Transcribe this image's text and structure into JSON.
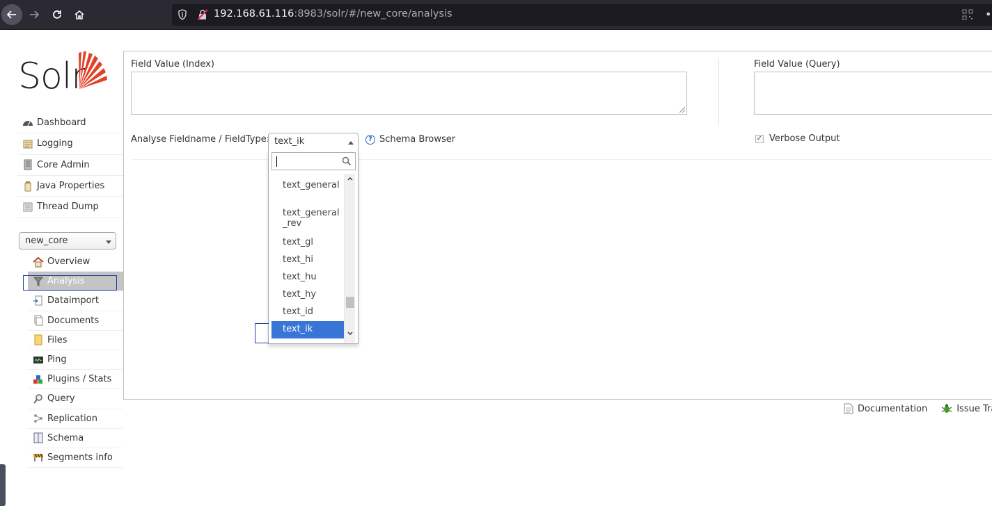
{
  "browser": {
    "url_host": "192.168.61.116",
    "url_rest": ":8983/solr/#/new_core/analysis"
  },
  "logo": {
    "text": "Solr"
  },
  "main_menu": [
    {
      "label": "Dashboard",
      "icon": "dashboard-icon"
    },
    {
      "label": "Logging",
      "icon": "logging-icon"
    },
    {
      "label": "Core Admin",
      "icon": "core-admin-icon"
    },
    {
      "label": "Java Properties",
      "icon": "java-properties-icon"
    },
    {
      "label": "Thread Dump",
      "icon": "thread-dump-icon"
    }
  ],
  "core_selector": {
    "value": "new_core"
  },
  "core_menu": [
    {
      "label": "Overview",
      "icon": "home-icon"
    },
    {
      "label": "Analysis",
      "icon": "funnel-icon",
      "active": true
    },
    {
      "label": "Dataimport",
      "icon": "dataimport-icon"
    },
    {
      "label": "Documents",
      "icon": "documents-icon"
    },
    {
      "label": "Files",
      "icon": "folder-icon"
    },
    {
      "label": "Ping",
      "icon": "ping-icon"
    },
    {
      "label": "Plugins / Stats",
      "icon": "plugins-icon"
    },
    {
      "label": "Query",
      "icon": "magnifier-icon"
    },
    {
      "label": "Replication",
      "icon": "replication-icon"
    },
    {
      "label": "Schema",
      "icon": "schema-icon"
    },
    {
      "label": "Segments info",
      "icon": "segments-icon"
    }
  ],
  "analysis": {
    "index_label": "Field Value (Index)",
    "query_label": "Field Value (Query)",
    "index_value": "",
    "query_value": "",
    "fieldtype_label": "Analyse Fieldname / FieldType:",
    "fieldtype_value": "text_ik",
    "schema_browser": "Schema Browser",
    "verbose_label": "Verbose Output",
    "verbose_checked": true
  },
  "dropdown": {
    "search_value": "",
    "options": [
      {
        "label": "text_general",
        "selected": false
      },
      {
        "label": "text_general_rev",
        "selected": false
      },
      {
        "label": "text_gl",
        "selected": false
      },
      {
        "label": "text_hi",
        "selected": false
      },
      {
        "label": "text_hu",
        "selected": false
      },
      {
        "label": "text_hy",
        "selected": false
      },
      {
        "label": "text_id",
        "selected": false
      },
      {
        "label": "text_ik",
        "selected": true
      }
    ]
  },
  "footer": {
    "documentation": "Documentation",
    "issue_tracker": "Issue Tra"
  },
  "colors": {
    "accent_selected": "#3875d7",
    "active_menu_bg": "#c4c4c4",
    "browser_chrome": "#2b2a33",
    "logo_red": "#e24027"
  }
}
